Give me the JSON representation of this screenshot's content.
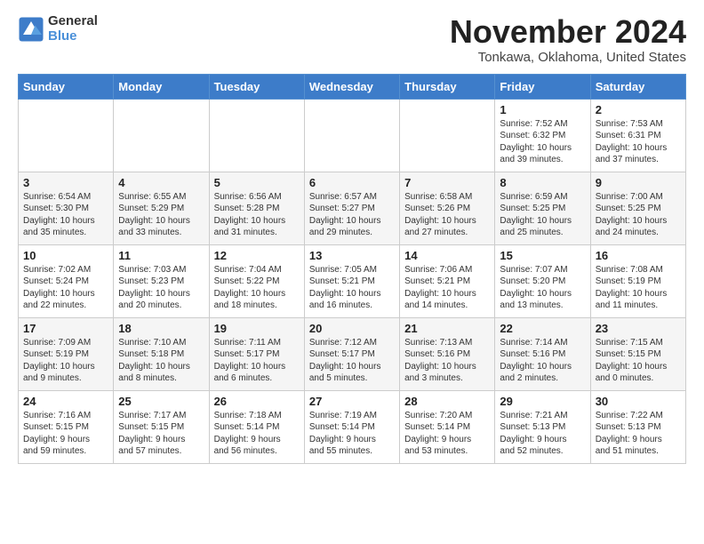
{
  "logo": {
    "general": "General",
    "blue": "Blue"
  },
  "title": "November 2024",
  "location": "Tonkawa, Oklahoma, United States",
  "headers": [
    "Sunday",
    "Monday",
    "Tuesday",
    "Wednesday",
    "Thursday",
    "Friday",
    "Saturday"
  ],
  "weeks": [
    [
      {
        "day": "",
        "info": ""
      },
      {
        "day": "",
        "info": ""
      },
      {
        "day": "",
        "info": ""
      },
      {
        "day": "",
        "info": ""
      },
      {
        "day": "",
        "info": ""
      },
      {
        "day": "1",
        "info": "Sunrise: 7:52 AM\nSunset: 6:32 PM\nDaylight: 10 hours\nand 39 minutes."
      },
      {
        "day": "2",
        "info": "Sunrise: 7:53 AM\nSunset: 6:31 PM\nDaylight: 10 hours\nand 37 minutes."
      }
    ],
    [
      {
        "day": "3",
        "info": "Sunrise: 6:54 AM\nSunset: 5:30 PM\nDaylight: 10 hours\nand 35 minutes."
      },
      {
        "day": "4",
        "info": "Sunrise: 6:55 AM\nSunset: 5:29 PM\nDaylight: 10 hours\nand 33 minutes."
      },
      {
        "day": "5",
        "info": "Sunrise: 6:56 AM\nSunset: 5:28 PM\nDaylight: 10 hours\nand 31 minutes."
      },
      {
        "day": "6",
        "info": "Sunrise: 6:57 AM\nSunset: 5:27 PM\nDaylight: 10 hours\nand 29 minutes."
      },
      {
        "day": "7",
        "info": "Sunrise: 6:58 AM\nSunset: 5:26 PM\nDaylight: 10 hours\nand 27 minutes."
      },
      {
        "day": "8",
        "info": "Sunrise: 6:59 AM\nSunset: 5:25 PM\nDaylight: 10 hours\nand 25 minutes."
      },
      {
        "day": "9",
        "info": "Sunrise: 7:00 AM\nSunset: 5:25 PM\nDaylight: 10 hours\nand 24 minutes."
      }
    ],
    [
      {
        "day": "10",
        "info": "Sunrise: 7:02 AM\nSunset: 5:24 PM\nDaylight: 10 hours\nand 22 minutes."
      },
      {
        "day": "11",
        "info": "Sunrise: 7:03 AM\nSunset: 5:23 PM\nDaylight: 10 hours\nand 20 minutes."
      },
      {
        "day": "12",
        "info": "Sunrise: 7:04 AM\nSunset: 5:22 PM\nDaylight: 10 hours\nand 18 minutes."
      },
      {
        "day": "13",
        "info": "Sunrise: 7:05 AM\nSunset: 5:21 PM\nDaylight: 10 hours\nand 16 minutes."
      },
      {
        "day": "14",
        "info": "Sunrise: 7:06 AM\nSunset: 5:21 PM\nDaylight: 10 hours\nand 14 minutes."
      },
      {
        "day": "15",
        "info": "Sunrise: 7:07 AM\nSunset: 5:20 PM\nDaylight: 10 hours\nand 13 minutes."
      },
      {
        "day": "16",
        "info": "Sunrise: 7:08 AM\nSunset: 5:19 PM\nDaylight: 10 hours\nand 11 minutes."
      }
    ],
    [
      {
        "day": "17",
        "info": "Sunrise: 7:09 AM\nSunset: 5:19 PM\nDaylight: 10 hours\nand 9 minutes."
      },
      {
        "day": "18",
        "info": "Sunrise: 7:10 AM\nSunset: 5:18 PM\nDaylight: 10 hours\nand 8 minutes."
      },
      {
        "day": "19",
        "info": "Sunrise: 7:11 AM\nSunset: 5:17 PM\nDaylight: 10 hours\nand 6 minutes."
      },
      {
        "day": "20",
        "info": "Sunrise: 7:12 AM\nSunset: 5:17 PM\nDaylight: 10 hours\nand 5 minutes."
      },
      {
        "day": "21",
        "info": "Sunrise: 7:13 AM\nSunset: 5:16 PM\nDaylight: 10 hours\nand 3 minutes."
      },
      {
        "day": "22",
        "info": "Sunrise: 7:14 AM\nSunset: 5:16 PM\nDaylight: 10 hours\nand 2 minutes."
      },
      {
        "day": "23",
        "info": "Sunrise: 7:15 AM\nSunset: 5:15 PM\nDaylight: 10 hours\nand 0 minutes."
      }
    ],
    [
      {
        "day": "24",
        "info": "Sunrise: 7:16 AM\nSunset: 5:15 PM\nDaylight: 9 hours\nand 59 minutes."
      },
      {
        "day": "25",
        "info": "Sunrise: 7:17 AM\nSunset: 5:15 PM\nDaylight: 9 hours\nand 57 minutes."
      },
      {
        "day": "26",
        "info": "Sunrise: 7:18 AM\nSunset: 5:14 PM\nDaylight: 9 hours\nand 56 minutes."
      },
      {
        "day": "27",
        "info": "Sunrise: 7:19 AM\nSunset: 5:14 PM\nDaylight: 9 hours\nand 55 minutes."
      },
      {
        "day": "28",
        "info": "Sunrise: 7:20 AM\nSunset: 5:14 PM\nDaylight: 9 hours\nand 53 minutes."
      },
      {
        "day": "29",
        "info": "Sunrise: 7:21 AM\nSunset: 5:13 PM\nDaylight: 9 hours\nand 52 minutes."
      },
      {
        "day": "30",
        "info": "Sunrise: 7:22 AM\nSunset: 5:13 PM\nDaylight: 9 hours\nand 51 minutes."
      }
    ]
  ]
}
